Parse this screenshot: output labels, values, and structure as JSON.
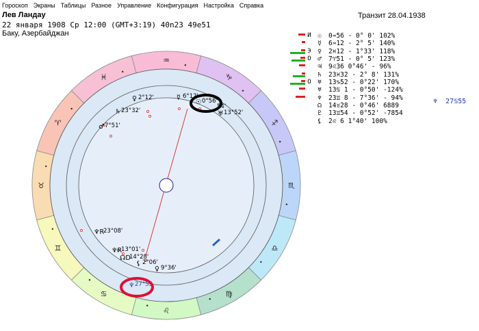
{
  "menu": [
    "Гороскоп",
    "Экраны",
    "Таблицы",
    "Разное",
    "Управление",
    "Конфигурация",
    "Настройка",
    "Справка"
  ],
  "chart_info": {
    "name": "Лев Ландау",
    "date_line": "22 января 1908  Ср  12:00 (GMT+3:19) 40n23  49e51",
    "city": "Баку, Азербайджан",
    "transit": "Транзит 28.04.1938"
  },
  "zodiac_ring": [
    {
      "sign": "♒",
      "color": "#f9bcd6"
    },
    {
      "sign": "♑",
      "color": "#e0c2f2"
    },
    {
      "sign": "♐",
      "color": "#c8c8f8"
    },
    {
      "sign": "♏",
      "color": "#bcd6fa"
    },
    {
      "sign": "♎",
      "color": "#bde8f8"
    },
    {
      "sign": "♍",
      "color": "#b4e0cc"
    },
    {
      "sign": "♌",
      "color": "#d2f8c4"
    },
    {
      "sign": "♋",
      "color": "#e6fac4"
    },
    {
      "sign": "♊",
      "color": "#f6f8bc"
    },
    {
      "sign": "♉",
      "color": "#f9dcb2"
    },
    {
      "sign": "♈",
      "color": "#f9c4b6"
    },
    {
      "sign": "♓",
      "color": "#f7c0d4"
    }
  ],
  "chart_planets": [
    {
      "glyph": "♀",
      "label": "2°12'",
      "color": "#000"
    },
    {
      "glyph": "☿",
      "label": "6°12'",
      "color": "#000"
    },
    {
      "glyph": "☉",
      "label": "0°56'",
      "color": "#000"
    },
    {
      "glyph": "",
      "label": "54'",
      "color": "#000"
    },
    {
      "glyph": "♅",
      "label": "13°52'",
      "color": "#000"
    },
    {
      "glyph": "♄",
      "label": "23°32'",
      "color": "#000"
    },
    {
      "glyph": "♂",
      "label": "7°51'",
      "color": "#000"
    },
    {
      "glyph": "♆R",
      "label": "23°08'",
      "color": "#000"
    },
    {
      "glyph": "♆R",
      "label": "13°01'",
      "color": "#000"
    },
    {
      "glyph": "☊D",
      "label": "14°28'",
      "color": "#000"
    },
    {
      "glyph": "⚸",
      "label": "2°06'",
      "color": "#000"
    },
    {
      "glyph": "♀",
      "label": "9°36'",
      "color": "#000"
    },
    {
      "glyph": "♆",
      "label": "27°55",
      "color": "#2244cc"
    }
  ],
  "planet_table": [
    {
      "glyph": "☉",
      "state": "И",
      "text": "0♒56 - 0° 0' 102%",
      "red": 10,
      "green": 0
    },
    {
      "glyph": "☿",
      "state": "",
      "text": "6♒12 - 2° 5' 140%",
      "red": 5,
      "green": 0
    },
    {
      "glyph": "♀",
      "state": "Э",
      "text": "2♓12 - 1°33' 118%",
      "red": 6,
      "green": 22
    },
    {
      "glyph": "♂",
      "state": "О",
      "text": "7♈51 - 0° 5' 123%",
      "red": 7,
      "green": 20
    },
    {
      "glyph": "♃",
      "state": "",
      "text": "9♌36   0°46' - 96%",
      "red": 9,
      "green": 0
    },
    {
      "glyph": "♄",
      "state": "",
      "text": "23♓32 - 2° 8' 131%",
      "red": 5,
      "green": 18
    },
    {
      "glyph": "♅",
      "state": "О",
      "text": "13♑52 - 0°22' 170%",
      "red": 6,
      "green": 22
    },
    {
      "glyph": "♅",
      "state": "",
      "text": "13♋ 1 - 0°50' -124%",
      "red": 9,
      "green": 0
    },
    {
      "glyph": "♆",
      "state": "",
      "text": "23♊ 8 - 7°36' - 94%",
      "red": 14,
      "green": 0
    },
    {
      "glyph": "☊",
      "state": "",
      "text": "14♉28 - 0°46' 6889",
      "red": 0,
      "green": 0
    },
    {
      "glyph": "♇",
      "state": "",
      "text": "13♊54 - 0°52' -7854",
      "red": 0,
      "green": 0
    },
    {
      "glyph": "⚸",
      "state": "",
      "text": "2♌ 6   1°40' 100%",
      "red": 0,
      "green": 0
    }
  ],
  "extra_planet": {
    "glyph": "♆",
    "text": "27♋55"
  },
  "accent_colors": {
    "highlight_black": "#000000",
    "highlight_red": "#dd1133",
    "axis_red": "#e02020",
    "blue_marker": "#2266cc",
    "inner_fill": "#dbe8f6"
  }
}
